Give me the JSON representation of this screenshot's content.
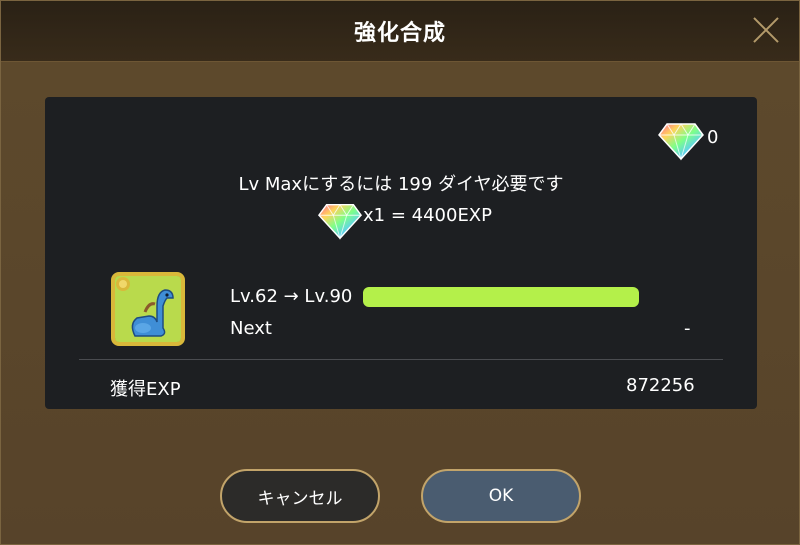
{
  "header": {
    "title": "強化合成"
  },
  "diamonds": {
    "count": "0"
  },
  "message": {
    "max_text": "Lv Maxにするには 199 ダイヤ必要です",
    "rate_text": "x1 = 4400EXP"
  },
  "level": {
    "text": "Lv.62 → Lv.90",
    "progress": 1.0,
    "bar_color": "#b4f04a"
  },
  "next": {
    "label": "Next",
    "value": "-"
  },
  "exp": {
    "label": "獲得EXP",
    "value": "872256"
  },
  "buttons": {
    "cancel": "キャンセル",
    "ok": "OK"
  },
  "icons": {
    "close": "close-icon",
    "diamond": "diamond-icon",
    "monster": "dinosaur-monster-icon"
  }
}
